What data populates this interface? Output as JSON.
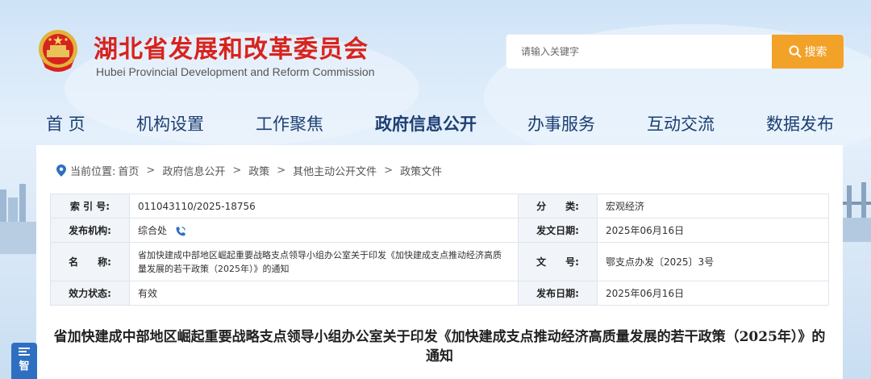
{
  "header": {
    "title": "湖北省发展和改革委员会",
    "subtitle": "Hubei Provincial Development and Reform Commission"
  },
  "search": {
    "placeholder": "请输入关键字",
    "button_label": "搜索"
  },
  "nav": {
    "items": [
      {
        "label": "首 页"
      },
      {
        "label": "机构设置"
      },
      {
        "label": "工作聚焦"
      },
      {
        "label": "政府信息公开",
        "active": true
      },
      {
        "label": "办事服务"
      },
      {
        "label": "互动交流"
      },
      {
        "label": "数据发布"
      }
    ]
  },
  "breadcrumb": {
    "prefix": "当前位置:",
    "items": [
      "首页",
      "政府信息公开",
      "政策",
      "其他主动公开文件",
      "政策文件"
    ]
  },
  "meta": {
    "index_label": "索 引 号:",
    "index_value": "011043110/2025-18756",
    "category_label": "分　　类:",
    "category_value": "宏观经济",
    "issuer_label": "发布机构:",
    "issuer_value": "综合处",
    "issue_date_label": "发文日期:",
    "issue_date_value": "2025年06月16日",
    "name_label": "名　　称:",
    "name_value": "省加快建成中部地区崛起重要战略支点领导小组办公室关于印发《加快建成支点推动经济高质量发展的若干政策（2025年）》的通知",
    "docno_label": "文　　号:",
    "docno_value": "鄂支点办发〔2025〕3号",
    "status_label": "效力状态:",
    "status_value": "有效",
    "publish_date_label": "发布日期:",
    "publish_date_value": "2025年06月16日"
  },
  "document": {
    "title": "省加快建成中部地区崛起重要战略支点领导小组办公室关于印发《加快建成支点推动经济高质量发展的若干政策（2025年）》的通知"
  },
  "side_tab": {
    "label": "智"
  },
  "colors": {
    "title_red": "#d8231d",
    "nav_blue": "#1c3f72",
    "search_orange": "#f2a229",
    "side_tab_blue": "#2f6fc2"
  }
}
